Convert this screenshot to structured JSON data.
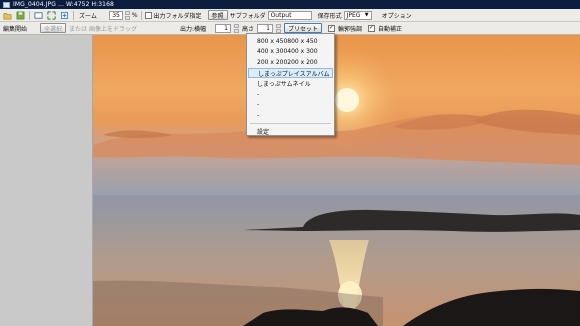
{
  "window": {
    "title": "IMG_0404.JPG ...  W:4752 H:3168"
  },
  "toolbar": {
    "zoom_label": "ズーム",
    "zoom_value": "35",
    "zoom_unit": "%",
    "output_folder_checkbox_label": "出力フォルダ指定",
    "browse_button": "参照",
    "subfolder_label": "サブフォルダ",
    "subfolder_value": "Output",
    "save_format_label": "保存形式",
    "save_format_value": "JPEG",
    "options_label": "オプション"
  },
  "toolbar2": {
    "edit_start": "編集開始",
    "select_all": "全選択",
    "drag_hint": "または 画像上をドラッグ",
    "output_width_label": "出力:横幅",
    "width_value": "1",
    "height_label": "高さ",
    "height_value": "1",
    "preset_button": "プリセット",
    "sharpen_label": "輪郭強調",
    "auto_correct_label": "自動補正"
  },
  "preset_menu": {
    "items": [
      "800 x 450800 x 450",
      "400 x 300400 x 300",
      "200 x 200200 x 200",
      "しまっぷプレイスアルバム",
      "しまっぷサムネイル",
      "-",
      "-",
      "-"
    ],
    "settings": "設定"
  },
  "colors": {
    "titlebar": "#0b1e3f",
    "menu_highlight": "#dcecfb"
  }
}
